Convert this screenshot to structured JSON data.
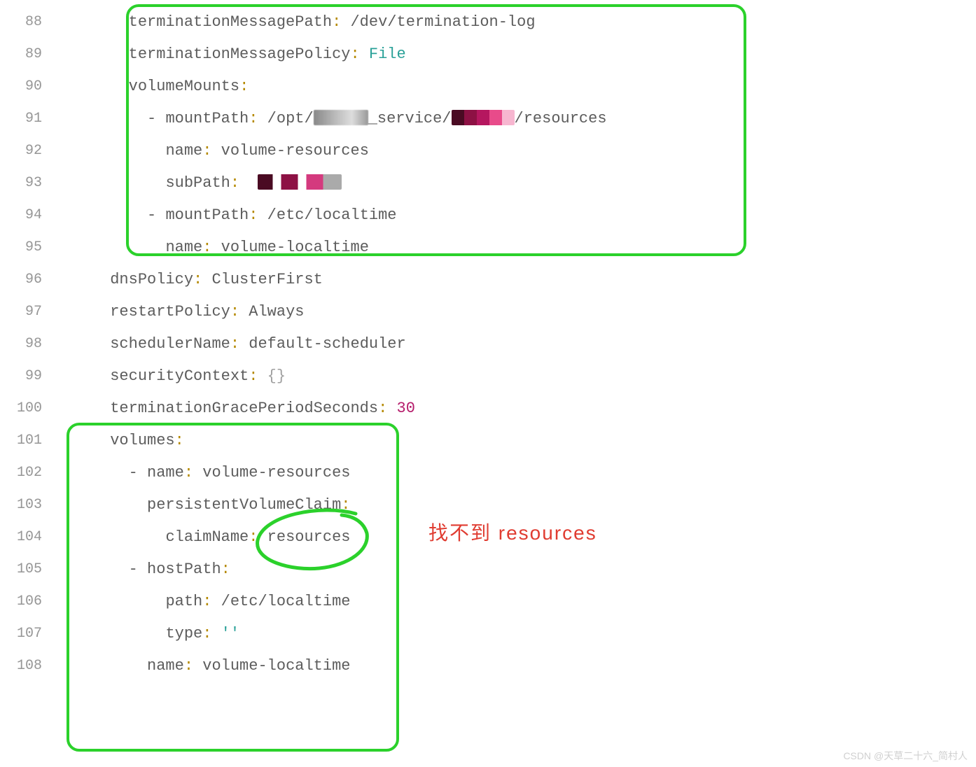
{
  "lines": [
    {
      "n": "88",
      "indent": 8,
      "dash": false,
      "key": "terminationMessagePath",
      "value": "/dev/termination-log",
      "valClass": "code"
    },
    {
      "n": "89",
      "indent": 8,
      "dash": false,
      "key": "terminationMessagePolicy",
      "value": "File",
      "valClass": "str"
    },
    {
      "n": "90",
      "indent": 8,
      "dash": false,
      "key": "volumeMounts",
      "value": "",
      "valClass": ""
    },
    {
      "n": "91",
      "indent": 10,
      "dash": true,
      "key": "mountPath",
      "value": "/opt/",
      "valClass": "code",
      "trail1": "_service/",
      "redact1": "g1",
      "redact2": "p1",
      "trail2": "/resources"
    },
    {
      "n": "92",
      "indent": 12,
      "dash": false,
      "key": "name",
      "value": "volume-resources",
      "valClass": "code"
    },
    {
      "n": "93",
      "indent": 12,
      "dash": false,
      "key": "subPath",
      "value": " ",
      "valClass": "code",
      "redact1": "p2"
    },
    {
      "n": "94",
      "indent": 10,
      "dash": true,
      "key": "mountPath",
      "value": "/etc/localtime",
      "valClass": "code"
    },
    {
      "n": "95",
      "indent": 12,
      "dash": false,
      "key": "name",
      "value": "volume-localtime",
      "valClass": "code"
    },
    {
      "n": "96",
      "indent": 6,
      "dash": false,
      "key": "dnsPolicy",
      "value": "ClusterFirst",
      "valClass": "code"
    },
    {
      "n": "97",
      "indent": 6,
      "dash": false,
      "key": "restartPolicy",
      "value": "Always",
      "valClass": "code"
    },
    {
      "n": "98",
      "indent": 6,
      "dash": false,
      "key": "schedulerName",
      "value": "default-scheduler",
      "valClass": "code"
    },
    {
      "n": "99",
      "indent": 6,
      "dash": false,
      "key": "securityContext",
      "value": "{}",
      "valClass": "braces"
    },
    {
      "n": "100",
      "indent": 6,
      "dash": false,
      "key": "terminationGracePeriodSeconds",
      "value": "30",
      "valClass": "num"
    },
    {
      "n": "101",
      "indent": 6,
      "dash": false,
      "key": "volumes",
      "value": "",
      "valClass": ""
    },
    {
      "n": "102",
      "indent": 8,
      "dash": true,
      "key": "name",
      "value": "volume-resources",
      "valClass": "code"
    },
    {
      "n": "103",
      "indent": 10,
      "dash": false,
      "key": "persistentVolumeClaim",
      "value": "",
      "valClass": ""
    },
    {
      "n": "104",
      "indent": 12,
      "dash": false,
      "key": "claimName",
      "value": "resources",
      "valClass": "code"
    },
    {
      "n": "105",
      "indent": 8,
      "dash": true,
      "key": "hostPath",
      "value": "",
      "valClass": ""
    },
    {
      "n": "106",
      "indent": 12,
      "dash": false,
      "key": "path",
      "value": "/etc/localtime",
      "valClass": "code"
    },
    {
      "n": "107",
      "indent": 12,
      "dash": false,
      "key": "type",
      "value": "''",
      "valClass": "str"
    },
    {
      "n": "108",
      "indent": 10,
      "dash": false,
      "key": "name",
      "value": "volume-localtime",
      "valClass": "code"
    }
  ],
  "annotation": "找不到 resources",
  "watermark": "CSDN @天草二十六_简村人"
}
